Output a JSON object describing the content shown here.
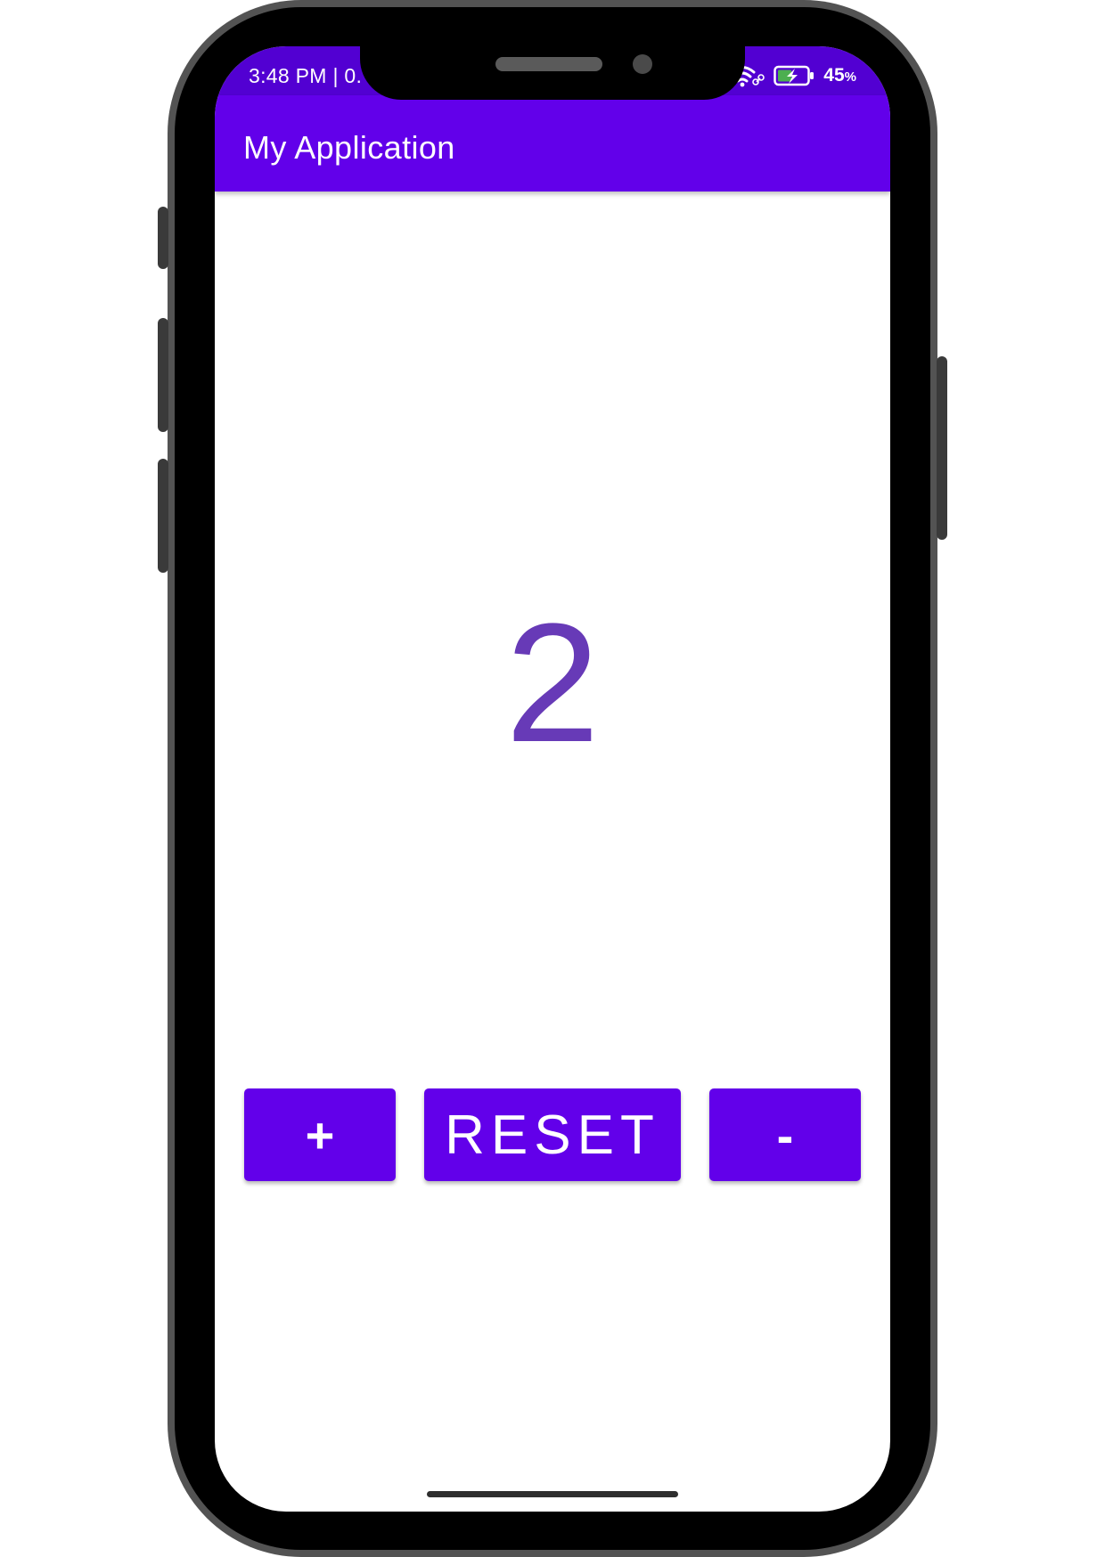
{
  "status_bar": {
    "time": "3:48 PM | 0.",
    "battery_percent": "45",
    "battery_unit": "%"
  },
  "app_bar": {
    "title": "My Application"
  },
  "counter": {
    "value": "2"
  },
  "buttons": {
    "increment_label": "+",
    "reset_label": "RESET",
    "decrement_label": "-"
  },
  "icons": {
    "wifi": "wifi-icon",
    "link": "link-icon",
    "battery": "battery-charging-icon"
  },
  "colors": {
    "status_bar": "#5200d2",
    "app_bar": "#6200ea",
    "button": "#6200ea",
    "counter_text": "#673ab7",
    "battery_fill": "#4caf50"
  }
}
